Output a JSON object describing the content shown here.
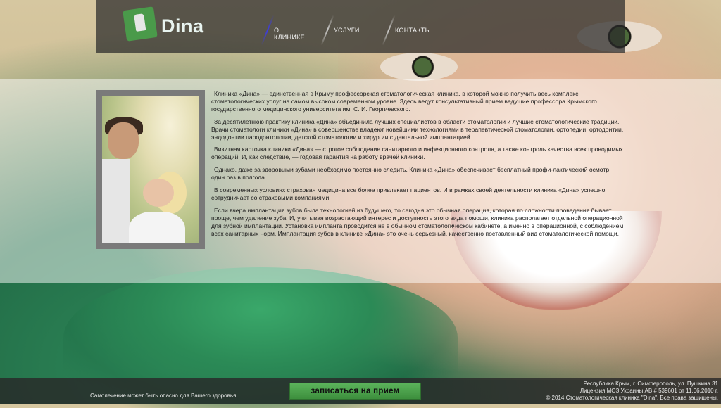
{
  "header": {
    "logo_text": "Dina",
    "nav": [
      {
        "label": "О КЛИНИКЕ"
      },
      {
        "label": "УСЛУГИ"
      },
      {
        "label": "КОНТАКТЫ"
      }
    ]
  },
  "article": {
    "paragraphs": [
      "Клиника «Дина» — единственная в Крыму профессорская стоматологическая клиника, в которой можно получить весь комплекс стоматологических услуг на самом высоком современном уровне. Здесь ведут консультативный прием ведущие профессора Крымского государственного медицинского университета им. С. И. Георгиевского.",
      "За десятилетнюю практику клиника «Дина» объединила лучших специалистов в области стоматологии и лучшие стоматологические традиции. Врачи стоматологи клиники «Дина» в совершенстве владеют новейшими технологиями в терапевтической стоматологии, ортопедии, ортодонтии, эндодонтии пародонтологии, детской стоматологии и хирургии с дентальной имплантацией.",
      "Визитная карточка клиники «Дина» — строгое соблюдение санитарного и инфекционного контроля, а также контроль качества всех проводимых операций. И, как следствие, — годовая гарантия на работу врачей клиники.",
      "Однако, даже за здоровыми зубами необходимо постоянно следить. Клиника «Дина» обеспечивает бесплатный профи-лактический осмотр один раз в полгода.",
      "В современных условиях страховая медицина все более привлекает пациентов. И в рамках своей деятельности клиника «Дина» успешно сотрудничает со страховыми компаниями.",
      "Если вчера имплантация зубов была технологией из будущего, то сегодня это обычная операция, которая по сложности проведения бывает проще, чем удаление зуба. И, учитывая возрастающий интерес и доступность этого вида помощи, клиника располагает отдельной операционной для зубной имплантации. Установка импланта проводится не в обычном стоматологическом кабинете, а именно в операционной, с соблюдением всех санитарных норм. Имплантация зубов в клинике «Дина» это очень серьезный, качественно поставленный вид стоматологической помощи."
    ]
  },
  "footer": {
    "warning": "Самолечение может быть опасно для Вашего здоровья!",
    "cta_label": "записаться на прием",
    "address": "Республика Крым, г. Симферополь, ул. Пушкина 31",
    "license": "Лицензия МОЗ Украины АВ # 539601 от 11.06.2010 г.",
    "copyright": "© 2014 Стоматологическая клиника \"Dina\". Все права защищены."
  },
  "icons": {
    "logo": "tooth-implant-icon"
  }
}
